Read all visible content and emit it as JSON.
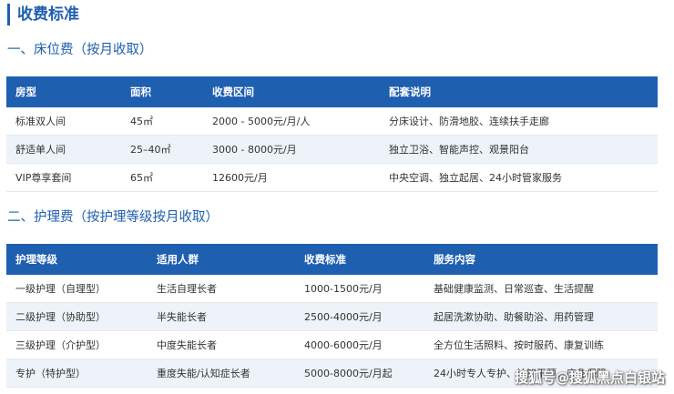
{
  "page_title": "收费标准",
  "section1": {
    "title": "一、床位费（按月收取）",
    "headers": [
      "房型",
      "面积",
      "收费区间",
      "配套说明"
    ],
    "rows": [
      [
        "标准双人间",
        "45㎡",
        "2000 - 5000元/月/人",
        "分床设计、防滑地胶、连续扶手走廊"
      ],
      [
        "舒适单人间",
        "25–40㎡",
        "3000 - 8000元/月",
        "独立卫浴、智能声控、观景阳台"
      ],
      [
        "VIP尊享套间",
        "65㎡",
        "12600元/月",
        "中央空调、独立起居、24小时管家服务"
      ]
    ]
  },
  "section2": {
    "title": "二、护理费（按护理等级按月收取）",
    "headers": [
      "护理等级",
      "适用人群",
      "收费标准",
      "服务内容"
    ],
    "rows": [
      [
        "一级护理（自理型）",
        "生活自理长者",
        "1000-1500元/月",
        "基础健康监测、日常巡查、生活提醒"
      ],
      [
        "二级护理（协助型）",
        "半失能长者",
        "2500-4000元/月",
        "起居洗漱协助、助餐助浴、用药管理"
      ],
      [
        "三级护理（介护型）",
        "中度失能长者",
        "4000-6000元/月",
        "全方位生活照料、按时服药、康复训练"
      ],
      [
        "专护（特护型）",
        "重度失能/认知症长者",
        "5000-8000元/月起",
        "24小时专人专护、认知干预、应急保障"
      ]
    ]
  },
  "watermark": "搜狐号@搜狐黑点白银站"
}
